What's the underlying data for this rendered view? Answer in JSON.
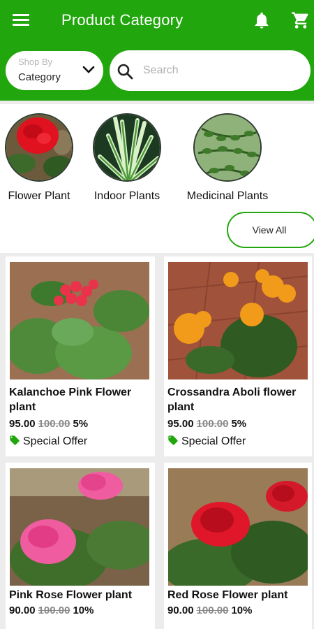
{
  "header": {
    "title": "Product Category",
    "icons": [
      "menu-icon",
      "bell-icon",
      "cart-icon"
    ],
    "brand_color": "#22a60d"
  },
  "filter": {
    "shop_by_label": "Shop By",
    "shop_by_value": "Category",
    "search_placeholder": "Search"
  },
  "categories": [
    {
      "label": "Flower Plant"
    },
    {
      "label": "Indoor Plants"
    },
    {
      "label": "Medicinal Plants"
    }
  ],
  "view_all_label": "View All",
  "products": [
    {
      "name": "Kalanchoe Pink Flower plant",
      "price": "95.00",
      "old_price": "100.00",
      "discount": "5%",
      "offer": "Special Offer"
    },
    {
      "name": "Crossandra Aboli flower plant",
      "price": "95.00",
      "old_price": "100.00",
      "discount": "5%",
      "offer": "Special Offer"
    },
    {
      "name": "Pink Rose Flower plant",
      "price": "90.00",
      "old_price": "100.00",
      "discount": "10%"
    },
    {
      "name": "Red Rose Flower plant",
      "price": "90.00",
      "old_price": "100.00",
      "discount": "10%"
    }
  ]
}
